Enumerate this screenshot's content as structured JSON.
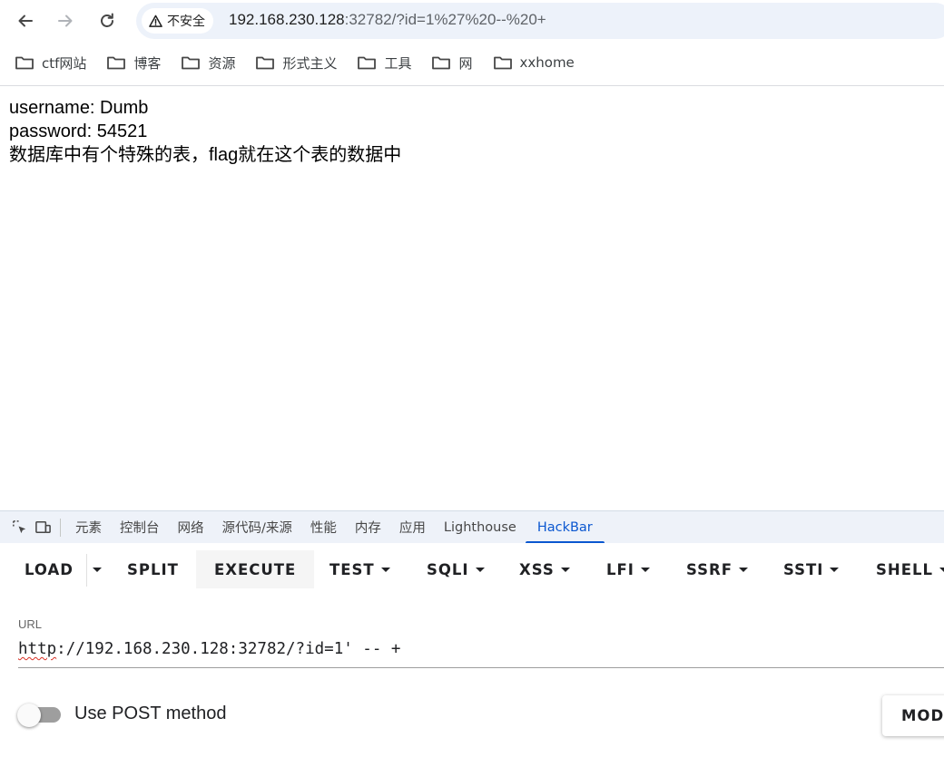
{
  "browser": {
    "security_label": "不安全",
    "url_host": "192.168.230.128",
    "url_rest": ":32782/?id=1%27%20--%20+"
  },
  "bookmarks": [
    {
      "label": "ctf网站"
    },
    {
      "label": "博客"
    },
    {
      "label": "资源"
    },
    {
      "label": "形式主义"
    },
    {
      "label": "工具"
    },
    {
      "label": "网"
    },
    {
      "label": "xxhome"
    }
  ],
  "page": {
    "line1": "username: Dumb",
    "line2": "password: 54521",
    "line3": "数据库中有个特殊的表，flag就在这个表的数据中"
  },
  "devtools": {
    "tabs": [
      "元素",
      "控制台",
      "网络",
      "源代码/来源",
      "性能",
      "内存",
      "应用",
      "Lighthouse",
      "HackBar"
    ],
    "active_tab": "HackBar"
  },
  "hackbar": {
    "buttons": {
      "load": "LOAD",
      "split": "SPLIT",
      "execute": "EXECUTE",
      "test": "TEST",
      "sqli": "SQLI",
      "xss": "XSS",
      "lfi": "LFI",
      "ssrf": "SSRF",
      "ssti": "SSTI",
      "shell": "SHELL"
    },
    "url_label": "URL",
    "url_scheme": "http",
    "url_value_rest": "://192.168.230.128:32782/?id=1' -- +",
    "post_method_label": "Use POST method",
    "post_method_enabled": false,
    "modify_label": "MODIFY"
  },
  "colors": {
    "accent": "#0b57d0",
    "omnibox_bg": "#edf2fa",
    "devtools_bar_bg": "#eef2f9"
  }
}
